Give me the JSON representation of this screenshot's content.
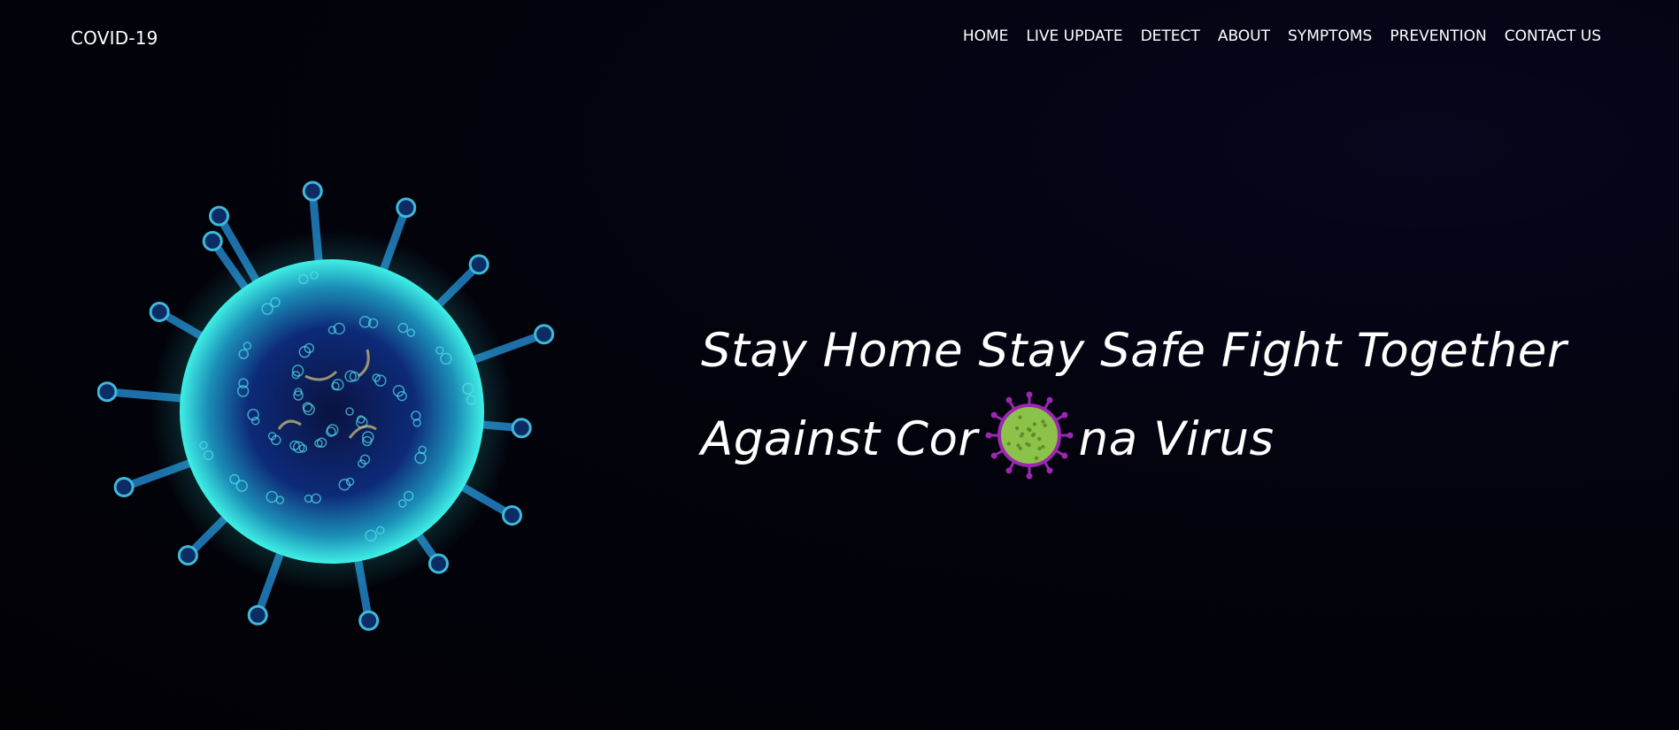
{
  "header": {
    "brand": "COVID-19",
    "nav": [
      "HOME",
      "LIVE UPDATE",
      "DETECT",
      "ABOUT",
      "SYMPTOMS",
      "PREVENTION",
      "CONTACT US"
    ]
  },
  "hero": {
    "line1": "Stay Home Stay Safe Fight Together",
    "line2_before": "Against Cor",
    "line2_after": "na Virus",
    "illustration": "coronavirus-illustration",
    "inline_icon": "virus-icon"
  },
  "colors": {
    "background": "#020208",
    "text": "#ffffff",
    "virus_glow": "#2fe3e0",
    "virus_body": "#0b1f5a",
    "icon_green": "#8bc34a",
    "icon_purple": "#9c27b0"
  }
}
